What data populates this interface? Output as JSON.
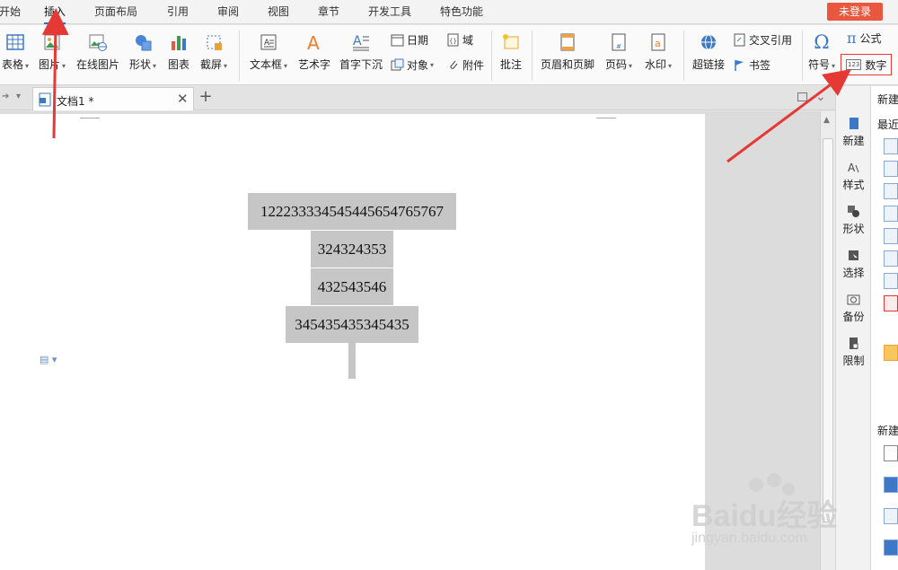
{
  "menu": {
    "items": [
      "开始",
      "插入",
      "页面布局",
      "引用",
      "审阅",
      "视图",
      "章节",
      "开发工具",
      "特色功能"
    ],
    "active_index": 1,
    "login_label": "未登录"
  },
  "ribbon": {
    "table": "表格",
    "image": "图片",
    "online_image": "在线图片",
    "shape": "形状",
    "chart": "图表",
    "screenshot": "截屏",
    "textbox": "文本框",
    "wordart": "艺术字",
    "dropcap": "首字下沉",
    "date": "日期",
    "field": "域",
    "object": "对象",
    "attachment": "附件",
    "comment": "批注",
    "header_footer": "页眉和页脚",
    "page_number": "页码",
    "watermark": "水印",
    "hyperlink": "超链接",
    "cross_ref": "交叉引用",
    "bookmark": "书签",
    "symbol": "符号",
    "formula_pi": "π",
    "formula": "公式",
    "number_icon": "123",
    "number": "数字",
    "omega": "Ω"
  },
  "tab": {
    "doc_title": "文档1 *",
    "close": "✕",
    "add": "+"
  },
  "document": {
    "lines": [
      "12223333454544565476576​7",
      "324324353",
      "432543546",
      "345435435345435"
    ]
  },
  "sidebar": {
    "items": [
      "新建",
      "样式",
      "形状",
      "选择",
      "备份",
      "限制"
    ]
  },
  "side_panel": {
    "top": "新建",
    "recent": "最近",
    "bottom": "新建"
  },
  "watermark": {
    "brand": "Baidu经验",
    "url": "jingyan.baidu.com"
  },
  "colors": {
    "accent_red": "#e53935",
    "login_bg": "#e9573f",
    "highlight_gray": "#c6c6c6"
  }
}
